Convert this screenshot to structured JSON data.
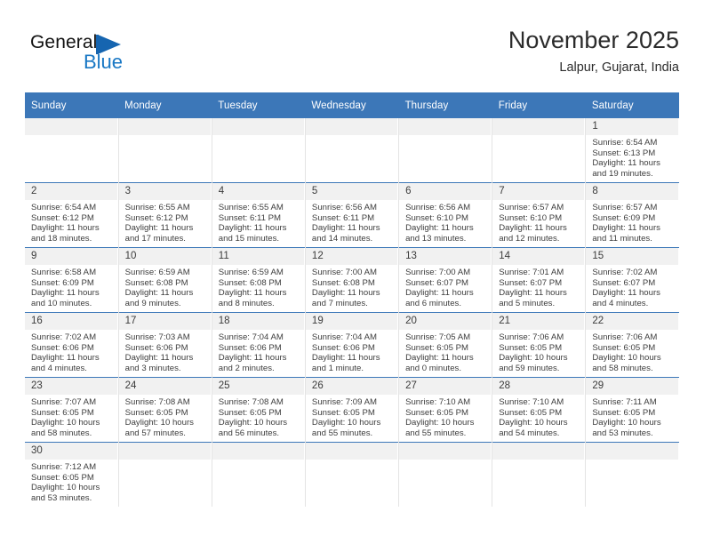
{
  "brand": {
    "name_top": "General",
    "name_bottom": "Blue",
    "accent_color": "#1665b0"
  },
  "header": {
    "title": "November 2025",
    "subtitle": "Lalpur, Gujarat, India"
  },
  "theme": {
    "header_blue": "#3c77b8",
    "daynum_band": "#f1f1f1",
    "text": "#3d3d3d"
  },
  "labels": {
    "sunrise_prefix": "Sunrise:",
    "sunset_prefix": "Sunset:",
    "daylight_prefix": "Daylight:"
  },
  "weekdays": [
    "Sunday",
    "Monday",
    "Tuesday",
    "Wednesday",
    "Thursday",
    "Friday",
    "Saturday"
  ],
  "weeks": [
    [
      {
        "day": "",
        "empty": true
      },
      {
        "day": "",
        "empty": true
      },
      {
        "day": "",
        "empty": true
      },
      {
        "day": "",
        "empty": true
      },
      {
        "day": "",
        "empty": true
      },
      {
        "day": "",
        "empty": true
      },
      {
        "day": "1",
        "sunrise": "Sunrise: 6:54 AM",
        "sunset": "Sunset: 6:13 PM",
        "daylight": "Daylight: 11 hours and 19 minutes."
      }
    ],
    [
      {
        "day": "2",
        "sunrise": "Sunrise: 6:54 AM",
        "sunset": "Sunset: 6:12 PM",
        "daylight": "Daylight: 11 hours and 18 minutes."
      },
      {
        "day": "3",
        "sunrise": "Sunrise: 6:55 AM",
        "sunset": "Sunset: 6:12 PM",
        "daylight": "Daylight: 11 hours and 17 minutes."
      },
      {
        "day": "4",
        "sunrise": "Sunrise: 6:55 AM",
        "sunset": "Sunset: 6:11 PM",
        "daylight": "Daylight: 11 hours and 15 minutes."
      },
      {
        "day": "5",
        "sunrise": "Sunrise: 6:56 AM",
        "sunset": "Sunset: 6:11 PM",
        "daylight": "Daylight: 11 hours and 14 minutes."
      },
      {
        "day": "6",
        "sunrise": "Sunrise: 6:56 AM",
        "sunset": "Sunset: 6:10 PM",
        "daylight": "Daylight: 11 hours and 13 minutes."
      },
      {
        "day": "7",
        "sunrise": "Sunrise: 6:57 AM",
        "sunset": "Sunset: 6:10 PM",
        "daylight": "Daylight: 11 hours and 12 minutes."
      },
      {
        "day": "8",
        "sunrise": "Sunrise: 6:57 AM",
        "sunset": "Sunset: 6:09 PM",
        "daylight": "Daylight: 11 hours and 11 minutes."
      }
    ],
    [
      {
        "day": "9",
        "sunrise": "Sunrise: 6:58 AM",
        "sunset": "Sunset: 6:09 PM",
        "daylight": "Daylight: 11 hours and 10 minutes."
      },
      {
        "day": "10",
        "sunrise": "Sunrise: 6:59 AM",
        "sunset": "Sunset: 6:08 PM",
        "daylight": "Daylight: 11 hours and 9 minutes."
      },
      {
        "day": "11",
        "sunrise": "Sunrise: 6:59 AM",
        "sunset": "Sunset: 6:08 PM",
        "daylight": "Daylight: 11 hours and 8 minutes."
      },
      {
        "day": "12",
        "sunrise": "Sunrise: 7:00 AM",
        "sunset": "Sunset: 6:08 PM",
        "daylight": "Daylight: 11 hours and 7 minutes."
      },
      {
        "day": "13",
        "sunrise": "Sunrise: 7:00 AM",
        "sunset": "Sunset: 6:07 PM",
        "daylight": "Daylight: 11 hours and 6 minutes."
      },
      {
        "day": "14",
        "sunrise": "Sunrise: 7:01 AM",
        "sunset": "Sunset: 6:07 PM",
        "daylight": "Daylight: 11 hours and 5 minutes."
      },
      {
        "day": "15",
        "sunrise": "Sunrise: 7:02 AM",
        "sunset": "Sunset: 6:07 PM",
        "daylight": "Daylight: 11 hours and 4 minutes."
      }
    ],
    [
      {
        "day": "16",
        "sunrise": "Sunrise: 7:02 AM",
        "sunset": "Sunset: 6:06 PM",
        "daylight": "Daylight: 11 hours and 4 minutes."
      },
      {
        "day": "17",
        "sunrise": "Sunrise: 7:03 AM",
        "sunset": "Sunset: 6:06 PM",
        "daylight": "Daylight: 11 hours and 3 minutes."
      },
      {
        "day": "18",
        "sunrise": "Sunrise: 7:04 AM",
        "sunset": "Sunset: 6:06 PM",
        "daylight": "Daylight: 11 hours and 2 minutes."
      },
      {
        "day": "19",
        "sunrise": "Sunrise: 7:04 AM",
        "sunset": "Sunset: 6:06 PM",
        "daylight": "Daylight: 11 hours and 1 minute."
      },
      {
        "day": "20",
        "sunrise": "Sunrise: 7:05 AM",
        "sunset": "Sunset: 6:05 PM",
        "daylight": "Daylight: 11 hours and 0 minutes."
      },
      {
        "day": "21",
        "sunrise": "Sunrise: 7:06 AM",
        "sunset": "Sunset: 6:05 PM",
        "daylight": "Daylight: 10 hours and 59 minutes."
      },
      {
        "day": "22",
        "sunrise": "Sunrise: 7:06 AM",
        "sunset": "Sunset: 6:05 PM",
        "daylight": "Daylight: 10 hours and 58 minutes."
      }
    ],
    [
      {
        "day": "23",
        "sunrise": "Sunrise: 7:07 AM",
        "sunset": "Sunset: 6:05 PM",
        "daylight": "Daylight: 10 hours and 58 minutes."
      },
      {
        "day": "24",
        "sunrise": "Sunrise: 7:08 AM",
        "sunset": "Sunset: 6:05 PM",
        "daylight": "Daylight: 10 hours and 57 minutes."
      },
      {
        "day": "25",
        "sunrise": "Sunrise: 7:08 AM",
        "sunset": "Sunset: 6:05 PM",
        "daylight": "Daylight: 10 hours and 56 minutes."
      },
      {
        "day": "26",
        "sunrise": "Sunrise: 7:09 AM",
        "sunset": "Sunset: 6:05 PM",
        "daylight": "Daylight: 10 hours and 55 minutes."
      },
      {
        "day": "27",
        "sunrise": "Sunrise: 7:10 AM",
        "sunset": "Sunset: 6:05 PM",
        "daylight": "Daylight: 10 hours and 55 minutes."
      },
      {
        "day": "28",
        "sunrise": "Sunrise: 7:10 AM",
        "sunset": "Sunset: 6:05 PM",
        "daylight": "Daylight: 10 hours and 54 minutes."
      },
      {
        "day": "29",
        "sunrise": "Sunrise: 7:11 AM",
        "sunset": "Sunset: 6:05 PM",
        "daylight": "Daylight: 10 hours and 53 minutes."
      }
    ],
    [
      {
        "day": "30",
        "sunrise": "Sunrise: 7:12 AM",
        "sunset": "Sunset: 6:05 PM",
        "daylight": "Daylight: 10 hours and 53 minutes."
      },
      {
        "day": "",
        "empty": true
      },
      {
        "day": "",
        "empty": true
      },
      {
        "day": "",
        "empty": true
      },
      {
        "day": "",
        "empty": true
      },
      {
        "day": "",
        "empty": true
      },
      {
        "day": "",
        "empty": true
      }
    ]
  ]
}
